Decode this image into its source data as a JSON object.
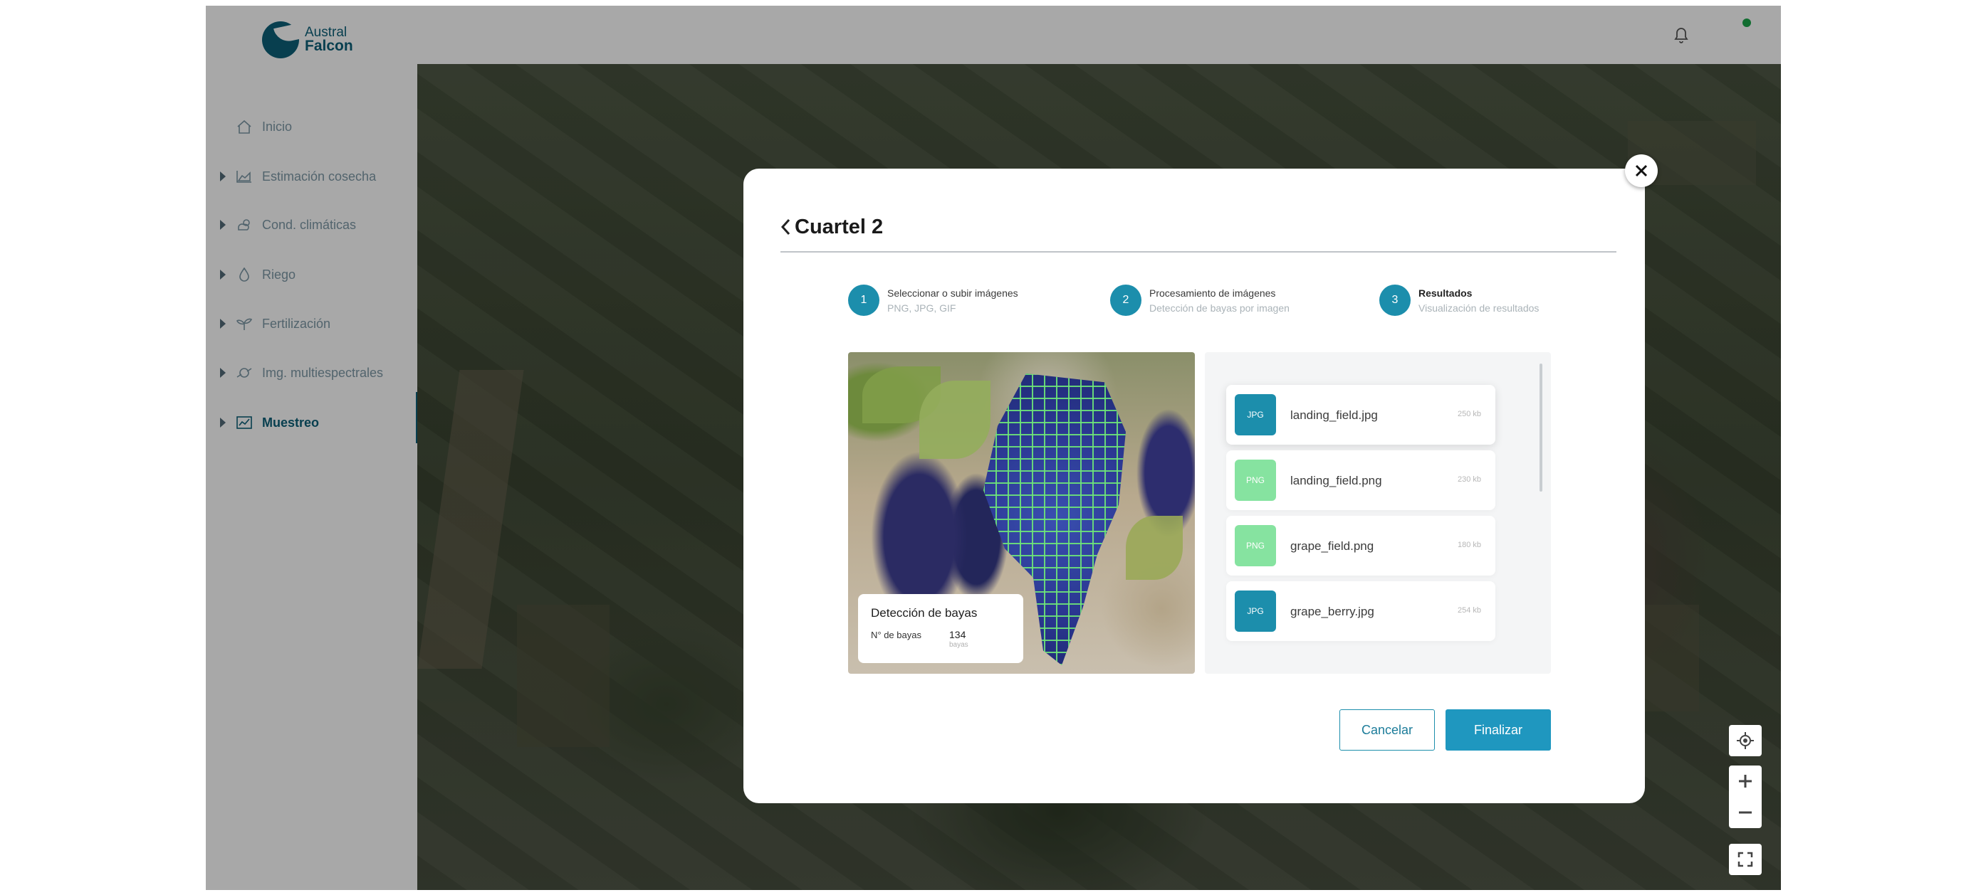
{
  "app": {
    "logo_line1": "Austral",
    "logo_line2": "Falcon",
    "brand_color": "#0d6079",
    "accent_color": "#1f97bf"
  },
  "sidebar": {
    "items": [
      {
        "label": "Inicio",
        "icon": "home-icon",
        "expandable": false
      },
      {
        "label": "Estimación cosecha",
        "icon": "area-chart-icon",
        "expandable": true
      },
      {
        "label": "Cond. climáticas",
        "icon": "cloud-sun-icon",
        "expandable": true
      },
      {
        "label": "Riego",
        "icon": "water-drop-icon",
        "expandable": true
      },
      {
        "label": "Fertilización",
        "icon": "plant-icon",
        "expandable": true
      },
      {
        "label": "Img. multiespectrales",
        "icon": "satellite-icon",
        "expandable": true
      },
      {
        "label": "Muestreo",
        "icon": "chart-icon",
        "expandable": true,
        "active": true
      }
    ]
  },
  "topbar": {
    "notification_icon": "bell-icon",
    "status_color": "#1aa64a"
  },
  "map_controls": [
    "locate-icon",
    "zoom-in-icon",
    "zoom-out-icon",
    "fullscreen-icon"
  ],
  "modal": {
    "title": "Cuartel 2",
    "steps": [
      {
        "number": "1",
        "title": "Seleccionar o subir imágenes",
        "subtitle": "PNG, JPG, GIF"
      },
      {
        "number": "2",
        "title": "Procesamiento de imágenes",
        "subtitle": "Detección de bayas por imagen"
      },
      {
        "number": "3",
        "title": "Resultados",
        "subtitle": "Visualización de resultados",
        "active": true
      }
    ],
    "detection": {
      "title": "Detección de bayas",
      "label": "N° de bayas",
      "value": "134",
      "unit": "bayas"
    },
    "files": [
      {
        "type": "JPG",
        "name": "landing_field.jpg",
        "size": "250 kb",
        "color": "#1c8eac",
        "selected": true
      },
      {
        "type": "PNG",
        "name": "landing_field.png",
        "size": "230 kb",
        "color": "#86e3a0",
        "selected": false
      },
      {
        "type": "PNG",
        "name": "grape_field.png",
        "size": "180 kb",
        "color": "#86e3a0",
        "selected": false
      },
      {
        "type": "JPG",
        "name": "grape_berry.jpg",
        "size": "254 kb",
        "color": "#1c8eac",
        "selected": false
      }
    ],
    "cancel_label": "Cancelar",
    "finish_label": "Finalizar"
  }
}
